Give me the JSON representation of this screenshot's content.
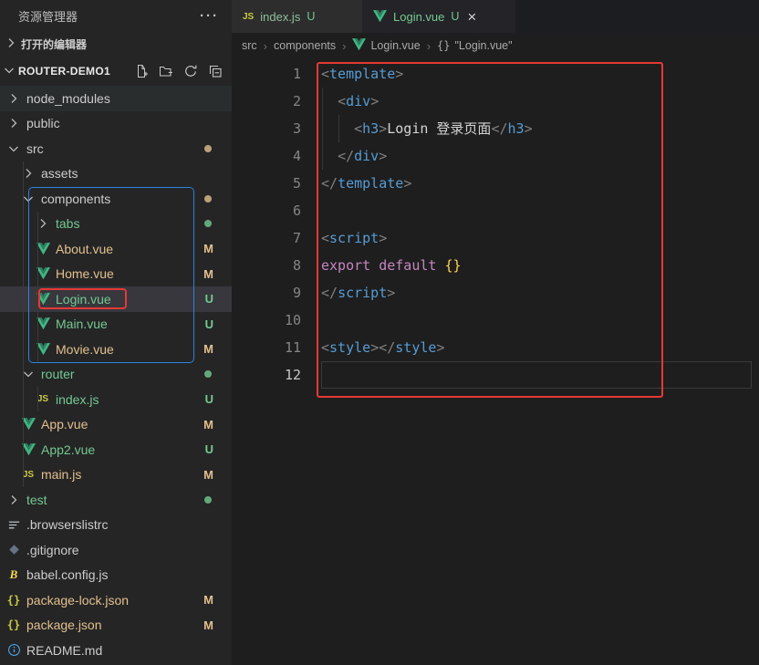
{
  "colors": {
    "modified": "#E2C08D",
    "untracked": "#73C991",
    "default_text": "#CCCCCC",
    "annotation_red": "#E53935",
    "annotation_blue": "#2B83E0",
    "code": {
      "punct": "#808080",
      "tag": "#569CD6",
      "text": "#D4D4D4",
      "keyword": "#C586C0",
      "brace": "#FFD64F"
    }
  },
  "sidebar": {
    "title": "资源管理器",
    "more_actions": "···",
    "open_editors_label": "打开的编辑器",
    "project_name": "ROUTER-DEMO1",
    "header_actions": [
      "new-file",
      "new-folder",
      "refresh",
      "collapse-all"
    ],
    "tree": [
      {
        "name": "node_modules",
        "kind": "folder",
        "indent": 0,
        "expanded": false,
        "hover": true
      },
      {
        "name": "public",
        "kind": "folder",
        "indent": 0,
        "expanded": false
      },
      {
        "name": "src",
        "kind": "folder",
        "indent": 0,
        "expanded": true,
        "dot": "modified"
      },
      {
        "name": "assets",
        "kind": "folder",
        "indent": 1,
        "expanded": false
      },
      {
        "name": "components",
        "kind": "folder",
        "indent": 1,
        "expanded": true,
        "dot": "modified"
      },
      {
        "name": "tabs",
        "kind": "folder",
        "indent": 2,
        "expanded": false,
        "status": "untracked",
        "dot": "untracked"
      },
      {
        "name": "About.vue",
        "kind": "vue",
        "indent": 2,
        "status": "modified",
        "badge": "M"
      },
      {
        "name": "Home.vue",
        "kind": "vue",
        "indent": 2,
        "status": "modified",
        "badge": "M"
      },
      {
        "name": "Login.vue",
        "kind": "vue",
        "indent": 2,
        "status": "untracked",
        "badge": "U",
        "selected": true
      },
      {
        "name": "Main.vue",
        "kind": "vue",
        "indent": 2,
        "status": "untracked",
        "badge": "U"
      },
      {
        "name": "Movie.vue",
        "kind": "vue",
        "indent": 2,
        "status": "modified",
        "badge": "M"
      },
      {
        "name": "router",
        "kind": "folder",
        "indent": 1,
        "expanded": true,
        "status": "untracked",
        "dot": "untracked"
      },
      {
        "name": "index.js",
        "kind": "js",
        "indent": 2,
        "status": "untracked",
        "badge": "U"
      },
      {
        "name": "App.vue",
        "kind": "vue",
        "indent": 1,
        "status": "modified",
        "badge": "M"
      },
      {
        "name": "App2.vue",
        "kind": "vue",
        "indent": 1,
        "status": "untracked",
        "badge": "U"
      },
      {
        "name": "main.js",
        "kind": "js",
        "indent": 1,
        "status": "modified",
        "badge": "M"
      },
      {
        "name": "test",
        "kind": "folder",
        "indent": 0,
        "expanded": false,
        "status": "untracked",
        "dot": "untracked"
      },
      {
        "name": ".browserslistrc",
        "kind": "browserslist",
        "indent": 0
      },
      {
        "name": ".gitignore",
        "kind": "gitignore",
        "indent": 0
      },
      {
        "name": "babel.config.js",
        "kind": "babel",
        "indent": 0
      },
      {
        "name": "package-lock.json",
        "kind": "json",
        "indent": 0,
        "status": "modified",
        "badge": "M"
      },
      {
        "name": "package.json",
        "kind": "json",
        "indent": 0,
        "status": "modified",
        "badge": "M"
      },
      {
        "name": "README.md",
        "kind": "readme",
        "indent": 0
      }
    ]
  },
  "tabs": [
    {
      "label": "index.js",
      "icon": "js",
      "git_badge": "U",
      "active": false
    },
    {
      "label": "Login.vue",
      "icon": "vue",
      "git_badge": "U",
      "active": true,
      "close_label": "×"
    }
  ],
  "breadcrumb": {
    "separator": "›",
    "items": [
      {
        "label": "src"
      },
      {
        "label": "components"
      },
      {
        "label": "Login.vue",
        "icon": "vue"
      },
      {
        "label": "\"Login.vue\"",
        "icon": "braces"
      }
    ]
  },
  "editor": {
    "active_line": 12,
    "lines": [
      {
        "num": 1,
        "tokens": [
          [
            "<",
            "punct"
          ],
          [
            "template",
            "tag"
          ],
          [
            ">",
            "punct"
          ]
        ]
      },
      {
        "num": 2,
        "tokens": [
          [
            "  ",
            "text"
          ],
          [
            "<",
            "punct"
          ],
          [
            "div",
            "tag"
          ],
          [
            ">",
            "punct"
          ]
        ]
      },
      {
        "num": 3,
        "tokens": [
          [
            "    ",
            "text"
          ],
          [
            "<",
            "punct"
          ],
          [
            "h3",
            "tag"
          ],
          [
            ">",
            "punct"
          ],
          [
            "Login 登录页面",
            "text"
          ],
          [
            "</",
            "punct"
          ],
          [
            "h3",
            "tag"
          ],
          [
            ">",
            "punct"
          ]
        ]
      },
      {
        "num": 4,
        "tokens": [
          [
            "  ",
            "text"
          ],
          [
            "</",
            "punct"
          ],
          [
            "div",
            "tag"
          ],
          [
            ">",
            "punct"
          ]
        ]
      },
      {
        "num": 5,
        "tokens": [
          [
            "</",
            "punct"
          ],
          [
            "template",
            "tag"
          ],
          [
            ">",
            "punct"
          ]
        ]
      },
      {
        "num": 6,
        "tokens": []
      },
      {
        "num": 7,
        "tokens": [
          [
            "<",
            "punct"
          ],
          [
            "script",
            "tag"
          ],
          [
            ">",
            "punct"
          ]
        ]
      },
      {
        "num": 8,
        "tokens": [
          [
            "export",
            "keyword"
          ],
          [
            " ",
            "text"
          ],
          [
            "default",
            "keyword"
          ],
          [
            " ",
            "text"
          ],
          [
            "{}",
            "brace"
          ]
        ]
      },
      {
        "num": 9,
        "tokens": [
          [
            "</",
            "punct"
          ],
          [
            "script",
            "tag"
          ],
          [
            ">",
            "punct"
          ]
        ]
      },
      {
        "num": 10,
        "tokens": []
      },
      {
        "num": 11,
        "tokens": [
          [
            "<",
            "punct"
          ],
          [
            "style",
            "tag"
          ],
          [
            ">",
            "punct"
          ],
          [
            "</",
            "punct"
          ],
          [
            "style",
            "tag"
          ],
          [
            ">",
            "punct"
          ]
        ]
      },
      {
        "num": 12,
        "tokens": []
      }
    ]
  }
}
